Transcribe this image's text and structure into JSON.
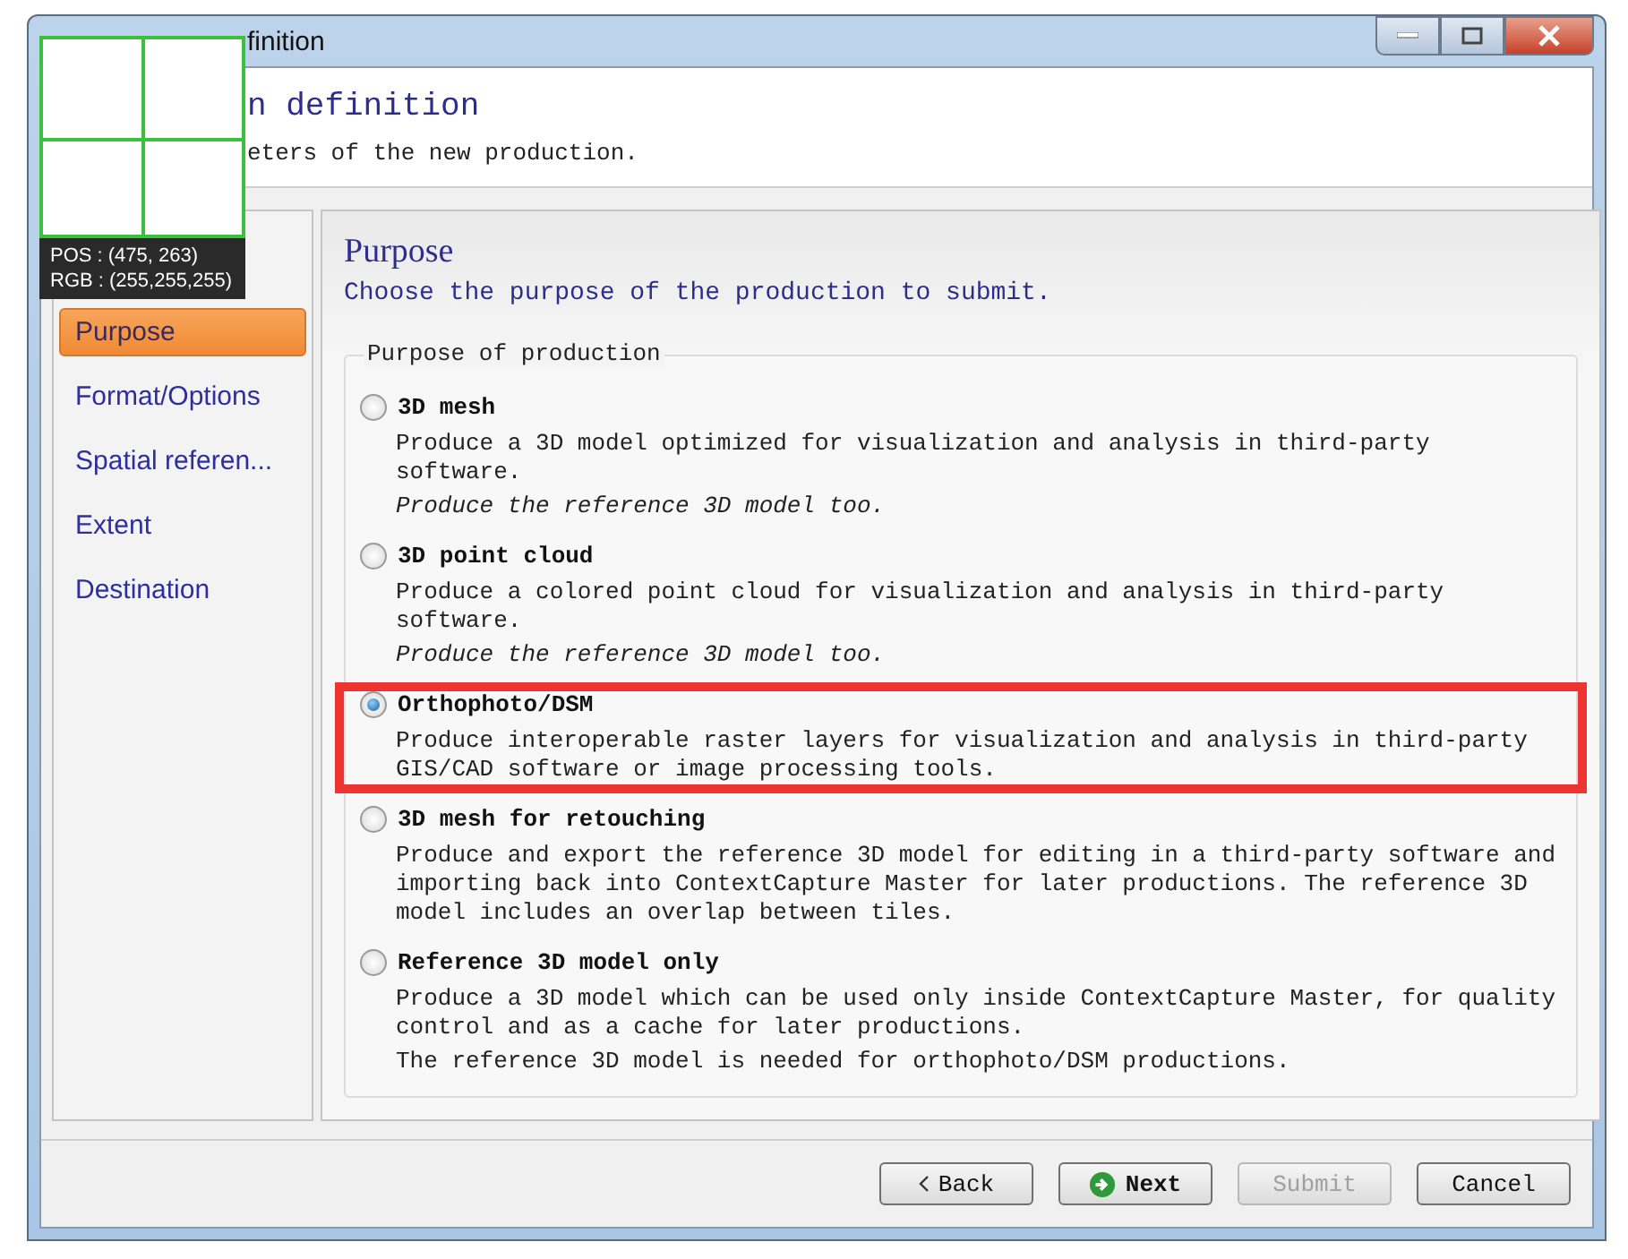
{
  "window": {
    "title": "finition"
  },
  "header": {
    "title": "n definition",
    "subtitle": "eters of the new production."
  },
  "loupe": {
    "pos": "POS : (475, 263)",
    "rgb": "RGB : (255,255,255)"
  },
  "sidebar": {
    "items": [
      {
        "label": "Purpose",
        "selected": true
      },
      {
        "label": "Format/Options",
        "selected": false
      },
      {
        "label": "Spatial referen...",
        "selected": false
      },
      {
        "label": "Extent",
        "selected": false
      },
      {
        "label": "Destination",
        "selected": false
      }
    ]
  },
  "page": {
    "title": "Purpose",
    "subtitle": "Choose the purpose of the production to submit."
  },
  "group": {
    "title": "Purpose of production",
    "options": [
      {
        "label": "3D mesh",
        "selected": false,
        "highlighted": false,
        "description": "Produce a 3D model optimized for visualization and analysis in third-party software.",
        "notes": [
          {
            "text": "Produce the reference 3D model too.",
            "italic": true
          }
        ]
      },
      {
        "label": "3D point cloud",
        "selected": false,
        "highlighted": false,
        "description": "Produce a colored point cloud for visualization and analysis in third-party software.",
        "notes": [
          {
            "text": "Produce the reference 3D model too.",
            "italic": true
          }
        ]
      },
      {
        "label": "Orthophoto/DSM",
        "selected": true,
        "highlighted": true,
        "description": "Produce interoperable raster layers for visualization and analysis in third-party GIS/CAD software or image processing tools."
      },
      {
        "label": "3D mesh for retouching",
        "selected": false,
        "highlighted": false,
        "description": "Produce and export the reference 3D model for editing in a third-party software and importing back into ContextCapture Master for later productions. The reference 3D model includes an overlap between tiles."
      },
      {
        "label": "Reference 3D model only",
        "selected": false,
        "highlighted": false,
        "description": "Produce a 3D model which can be used only inside ContextCapture Master, for quality control and as a cache for later productions.",
        "notes": [
          {
            "text": "The reference 3D model is needed for orthophoto/DSM productions.",
            "italic": false
          }
        ]
      }
    ]
  },
  "buttons": [
    {
      "label": "Back",
      "kind": "back",
      "disabled": false
    },
    {
      "label": "Next",
      "kind": "next",
      "disabled": false
    },
    {
      "label": "Submit",
      "kind": "plain",
      "disabled": true
    },
    {
      "label": "Cancel",
      "kind": "plain",
      "disabled": false
    }
  ]
}
